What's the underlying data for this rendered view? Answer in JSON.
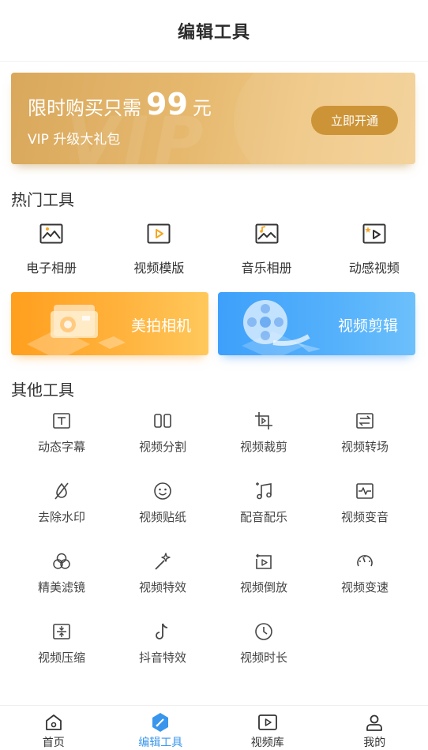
{
  "header": {
    "title": "编辑工具"
  },
  "banner": {
    "line_prefix": "限时购买只需",
    "price": "99",
    "unit": "元",
    "subtitle": "VIP 升级大礼包",
    "button_label": "立即开通",
    "watermark": "VIP",
    "accent_color": "#cd9437"
  },
  "hot_tools": {
    "title": "热门工具",
    "items": [
      {
        "label": "电子相册",
        "icon": "photo-album-icon"
      },
      {
        "label": "视频模版",
        "icon": "video-template-icon"
      },
      {
        "label": "音乐相册",
        "icon": "music-album-icon"
      },
      {
        "label": "动感视频",
        "icon": "dynamic-video-icon"
      }
    ]
  },
  "feature_cards": [
    {
      "label": "美拍相机",
      "icon": "camera-icon",
      "color": "#ff9f1e"
    },
    {
      "label": "视频剪辑",
      "icon": "film-reel-icon",
      "color": "#3ea0fb"
    }
  ],
  "other_tools": {
    "title": "其他工具",
    "items": [
      {
        "label": "动态字幕",
        "icon": "subtitle-icon"
      },
      {
        "label": "视频分割",
        "icon": "split-icon"
      },
      {
        "label": "视频裁剪",
        "icon": "crop-icon"
      },
      {
        "label": "视频转场",
        "icon": "transition-icon"
      },
      {
        "label": "去除水印",
        "icon": "remove-watermark-icon"
      },
      {
        "label": "视频贴纸",
        "icon": "sticker-icon"
      },
      {
        "label": "配音配乐",
        "icon": "music-icon"
      },
      {
        "label": "视频变音",
        "icon": "voice-change-icon"
      },
      {
        "label": "精美滤镜",
        "icon": "filter-icon"
      },
      {
        "label": "视频特效",
        "icon": "magic-wand-icon"
      },
      {
        "label": "视频倒放",
        "icon": "reverse-icon"
      },
      {
        "label": "视频变速",
        "icon": "speed-icon"
      },
      {
        "label": "视频压缩",
        "icon": "compress-icon"
      },
      {
        "label": "抖音特效",
        "icon": "tiktok-icon"
      },
      {
        "label": "视频时长",
        "icon": "clock-icon"
      }
    ]
  },
  "tabbar": {
    "active_color": "#3a96ec",
    "items": [
      {
        "label": "首页",
        "icon": "home-icon",
        "active": false
      },
      {
        "label": "编辑工具",
        "icon": "edit-tools-icon",
        "active": true
      },
      {
        "label": "视频库",
        "icon": "video-library-icon",
        "active": false
      },
      {
        "label": "我的",
        "icon": "profile-icon",
        "active": false
      }
    ]
  }
}
